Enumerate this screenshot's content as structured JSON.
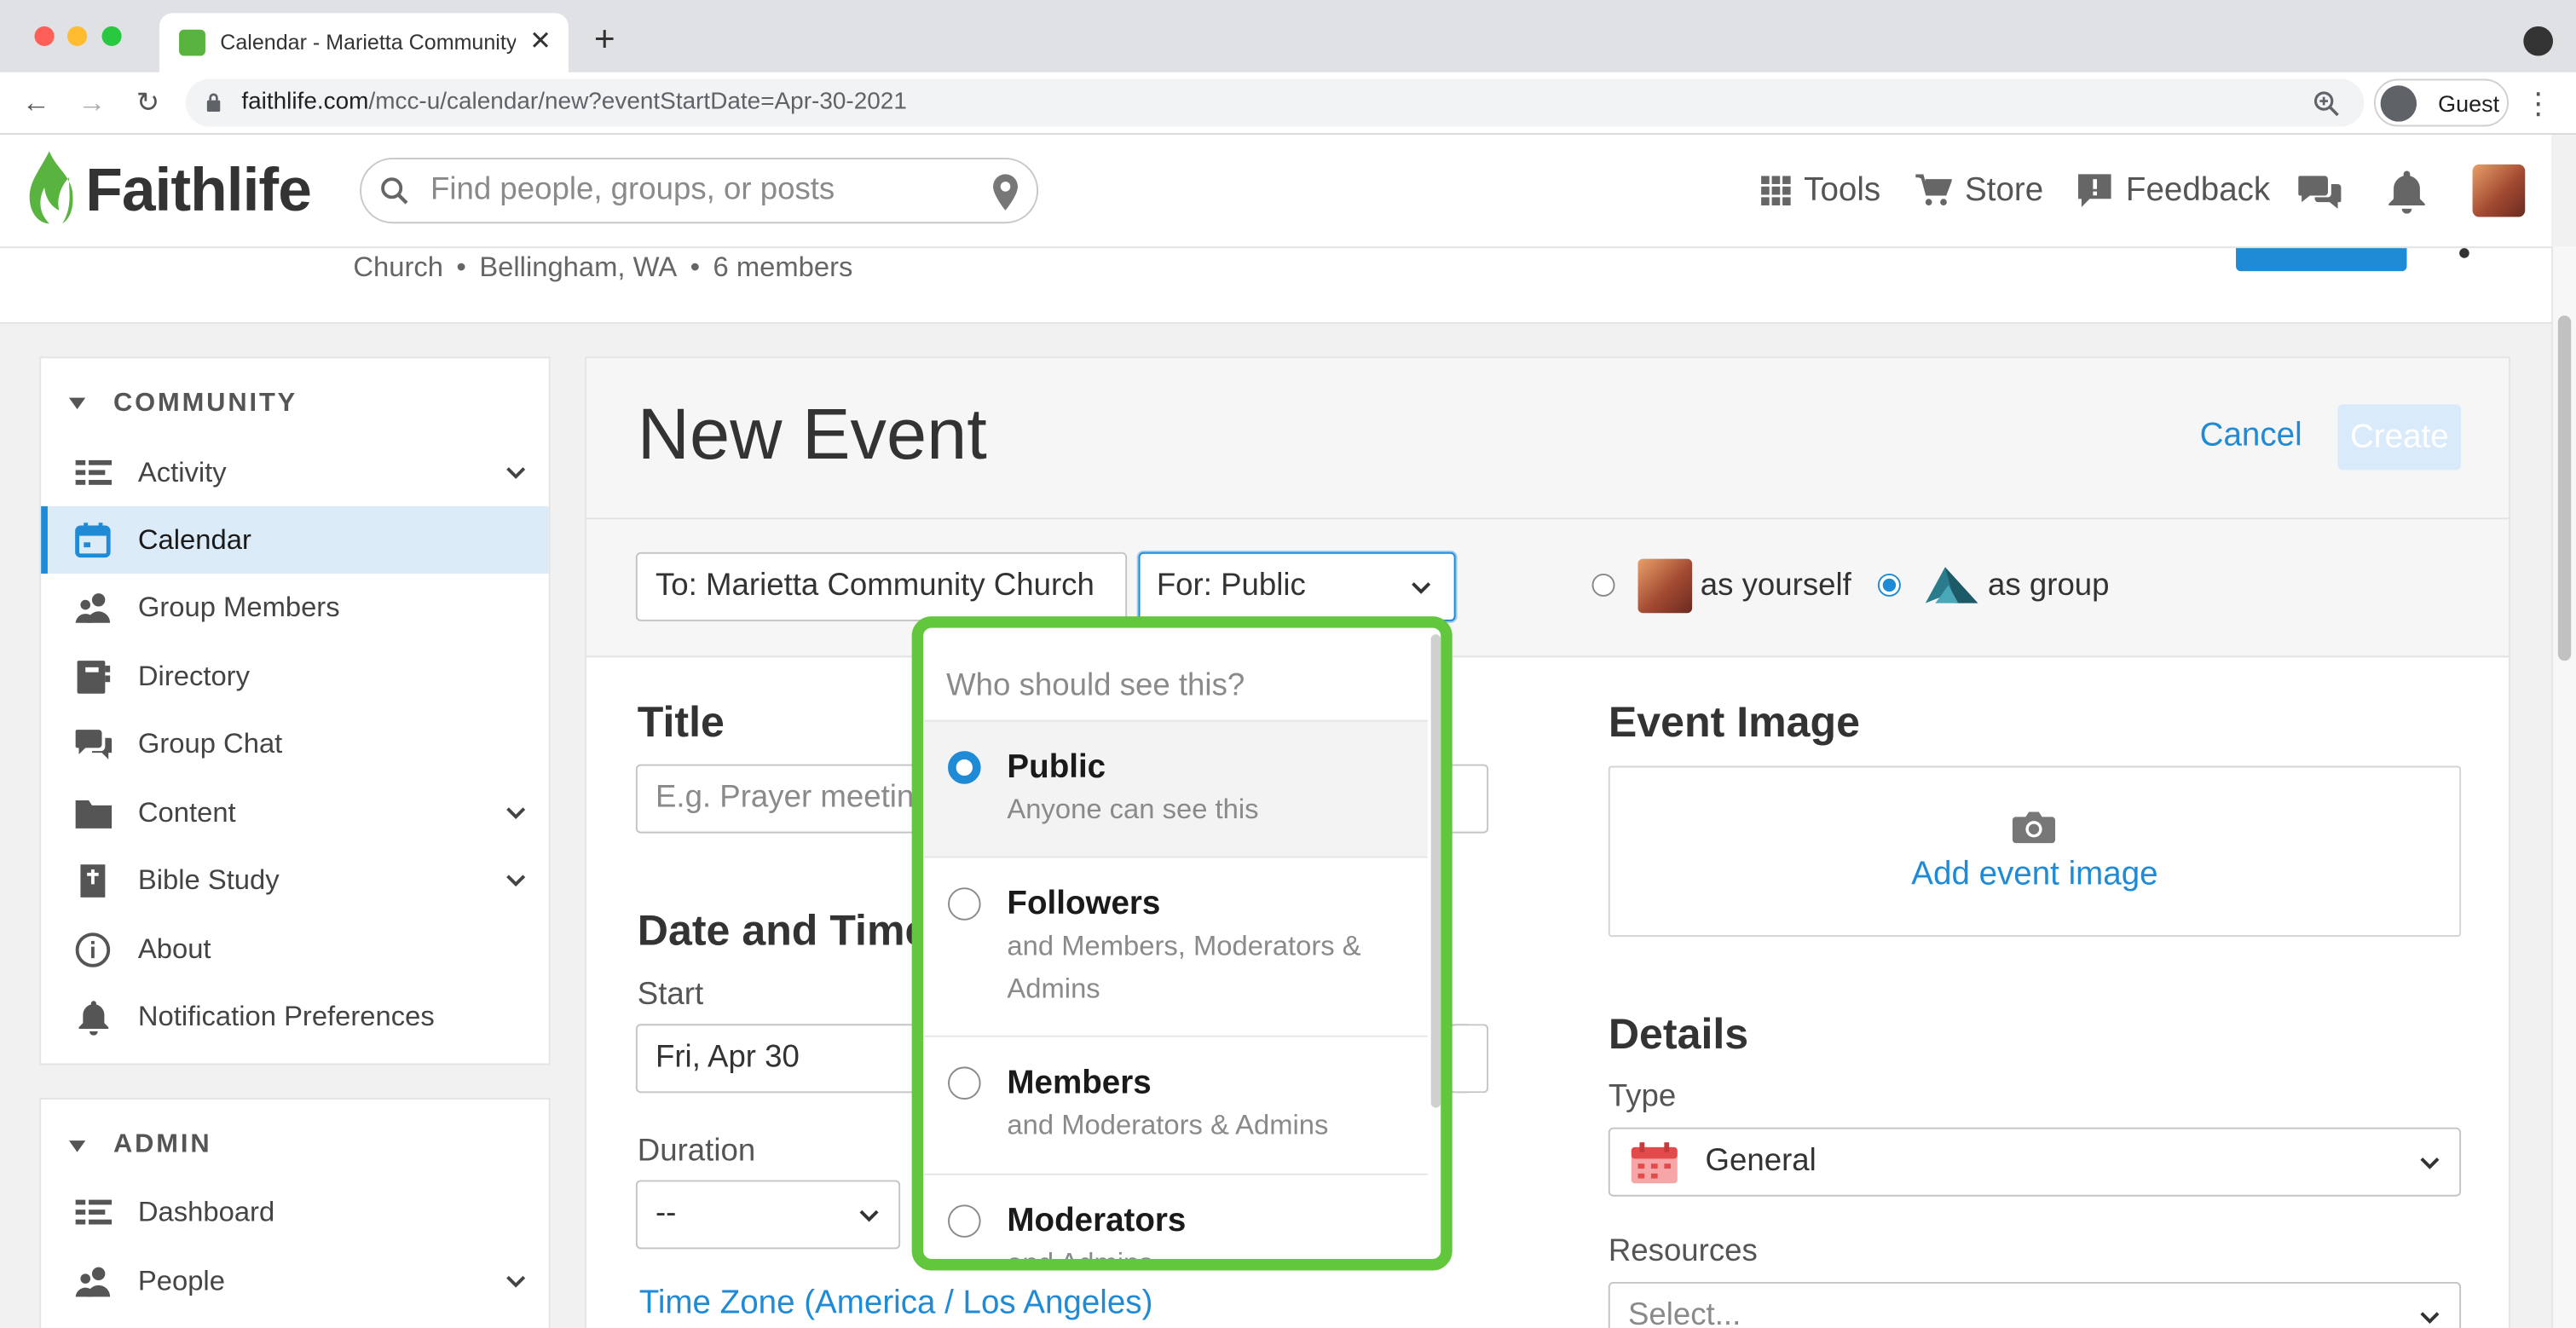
{
  "browser": {
    "tab_title": "Calendar - Marietta Community Church",
    "url_host": "faithlife.com",
    "url_path": "/mcc-u/calendar/new?eventStartDate=Apr-30-2021",
    "profile_label": "Guest"
  },
  "header": {
    "logo_text": "Faithlife",
    "search_placeholder": "Find people, groups, or posts",
    "nav": {
      "tools": "Tools",
      "store": "Store",
      "feedback": "Feedback"
    }
  },
  "group": {
    "type": "Church",
    "location": "Bellingham, WA",
    "members": "6 members"
  },
  "sidebar": {
    "community_heading": "COMMUNITY",
    "community_items": [
      {
        "label": "Activity",
        "icon": "activity-list-icon",
        "expandable": true
      },
      {
        "label": "Calendar",
        "icon": "calendar-icon",
        "active": true
      },
      {
        "label": "Group Members",
        "icon": "people-icon"
      },
      {
        "label": "Directory",
        "icon": "directory-book-icon"
      },
      {
        "label": "Group Chat",
        "icon": "chat-bubbles-icon"
      },
      {
        "label": "Content",
        "icon": "folder-icon",
        "expandable": true
      },
      {
        "label": "Bible Study",
        "icon": "bible-icon",
        "expandable": true
      },
      {
        "label": "About",
        "icon": "info-icon"
      },
      {
        "label": "Notification Preferences",
        "icon": "bell-icon"
      }
    ],
    "admin_heading": "ADMIN",
    "admin_items": [
      {
        "label": "Dashboard",
        "icon": "dashboard-list-icon"
      },
      {
        "label": "People",
        "icon": "people-icon",
        "expandable": true
      }
    ]
  },
  "event_form": {
    "page_title": "New Event",
    "cancel_label": "Cancel",
    "create_label": "Create",
    "to_value": "To: Marietta Community Church",
    "for_value": "For: Public",
    "as_yourself_label": "as yourself",
    "as_group_label": "as group",
    "post_as": "group",
    "title_heading": "Title",
    "title_placeholder": "E.g. Prayer meeting",
    "date_time_heading": "Date and Time",
    "start_label": "Start",
    "start_value": "Fri, Apr 30",
    "duration_label": "Duration",
    "duration_value": "--",
    "timezone_link": "Time Zone (America / Los Angeles)",
    "event_image_heading": "Event Image",
    "add_image_label": "Add event image",
    "details_heading": "Details",
    "type_label": "Type",
    "type_value": "General",
    "resources_label": "Resources",
    "resources_placeholder": "Select..."
  },
  "visibility_dropdown": {
    "header": "Who should see this?",
    "options": [
      {
        "title": "Public",
        "description": "Anyone can see this",
        "selected": true
      },
      {
        "title": "Followers",
        "description": "and Members, Moderators & Admins",
        "selected": false
      },
      {
        "title": "Members",
        "description": "and Moderators & Admins",
        "selected": false
      },
      {
        "title": "Moderators",
        "description": "and Admins",
        "selected": false
      }
    ]
  },
  "colors": {
    "accent_blue": "#1f8ad6",
    "brand_green": "#58b33f",
    "highlight_green": "#63c73d",
    "active_nav_bg": "#dcebf8"
  }
}
